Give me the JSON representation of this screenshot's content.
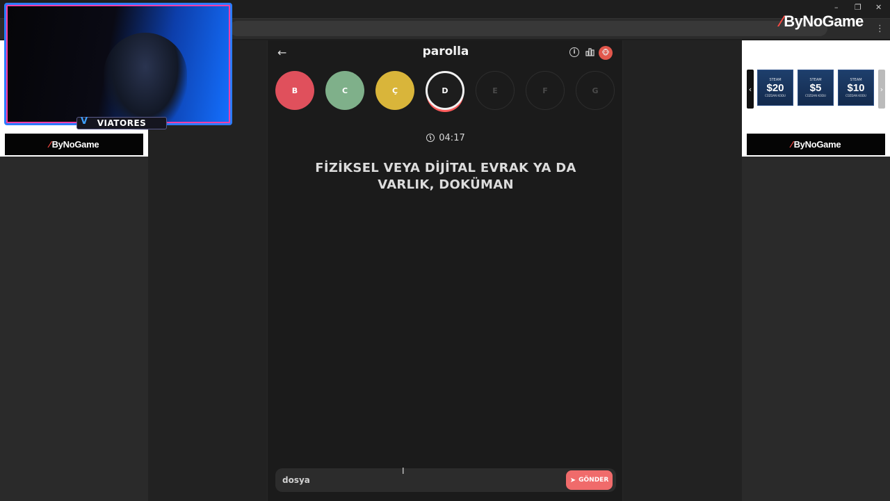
{
  "browser": {
    "brand": "ByNoGame",
    "window_controls": [
      "–",
      "❐",
      "✕"
    ]
  },
  "stream": {
    "streamer_name": "VIATORES"
  },
  "ads": {
    "left_banner_brand": "ByNoGame",
    "right_banner_brand": "ByNoGame",
    "steam_cards": [
      {
        "label": "STEAM",
        "value": "$20",
        "caption": "CÜZDAN KODU"
      },
      {
        "label": "STEAM",
        "value": "$5",
        "caption": "CÜZDAN KODU"
      },
      {
        "label": "STEAM",
        "value": "$10",
        "caption": "CÜZDAN KODU"
      }
    ]
  },
  "game": {
    "title": "parolla",
    "letters": [
      {
        "char": "B",
        "state": "wrong",
        "color": "#e0505c"
      },
      {
        "char": "C",
        "state": "correct",
        "color": "#7fb08a"
      },
      {
        "char": "Ç",
        "state": "passed",
        "color": "#d9b53a"
      },
      {
        "char": "D",
        "state": "current",
        "color": "#1d1d1d"
      },
      {
        "char": "E",
        "state": "pending",
        "color": "transparent"
      },
      {
        "char": "F",
        "state": "pending",
        "color": "transparent"
      },
      {
        "char": "G",
        "state": "pending",
        "color": "transparent"
      }
    ],
    "timer": "04:17",
    "question": "FİZİKSEL VEYA DİJİTAL EVRAK YA DA VARLIK, DOKÜMAN",
    "answer_value": "dosya",
    "send_label": "GÖNDER"
  },
  "colors": {
    "accent": "#f06b6b",
    "panel_bg": "#1b1b1b"
  }
}
